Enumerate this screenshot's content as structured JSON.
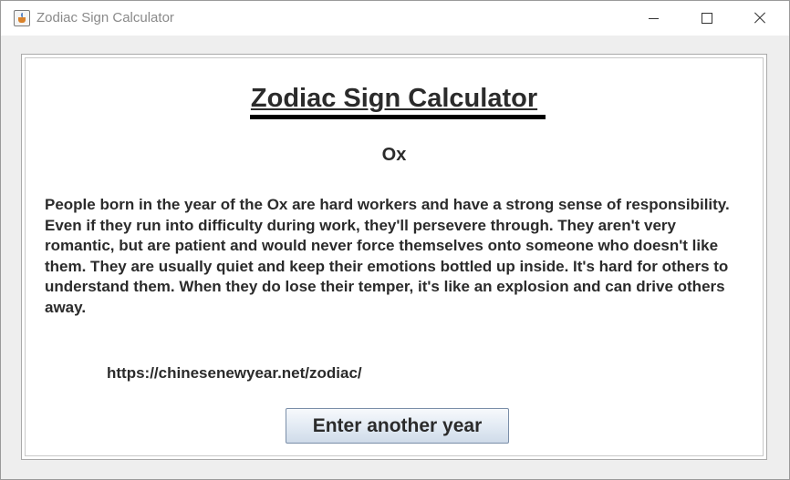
{
  "window": {
    "title": "Zodiac Sign Calculator",
    "icon": "java-cup-icon",
    "controls": [
      "minimize-icon",
      "maximize-icon",
      "close-icon"
    ]
  },
  "main": {
    "heading": "Zodiac Sign Calculator",
    "sign": "Ox",
    "description": "People born in the year of the Ox are hard workers and have a strong sense of responsibility. Even if they run into difficulty during work, they'll persevere through. They aren't very romantic, but are patient and would never force themselves onto someone who doesn't like them. They are usually quiet and keep their emotions bottled up inside. It's hard for others to understand them. When they do lose their temper, it's like an explosion and can drive others away.",
    "link": "https://chinesenewyear.net/zodiac/",
    "button_label": "Enter another year"
  },
  "colors": {
    "text": "#2b2b2b",
    "background": "#eeeeee",
    "button_top": "#f7f9fc",
    "button_bottom": "#cfdbe9",
    "button_border": "#7a8ea8"
  }
}
